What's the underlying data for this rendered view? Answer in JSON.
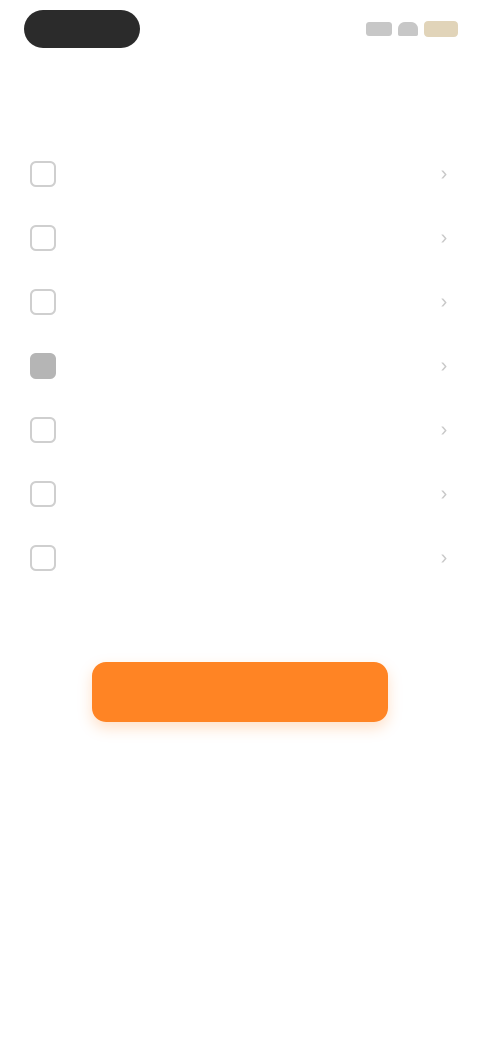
{
  "status_bar": {
    "time": "",
    "pill_color": "#2b2b2b"
  },
  "header": {
    "title": ""
  },
  "menu": {
    "items": [
      {
        "label": "",
        "icon": "item-icon"
      },
      {
        "label": "",
        "icon": "item-icon"
      },
      {
        "label": "",
        "icon": "item-icon"
      },
      {
        "label": "",
        "icon": "item-icon"
      },
      {
        "label": "",
        "icon": "item-icon"
      },
      {
        "label": "",
        "icon": "item-icon"
      },
      {
        "label": "",
        "icon": "item-icon"
      }
    ]
  },
  "action": {
    "button_label": "",
    "accent_color": "#ff8424"
  }
}
